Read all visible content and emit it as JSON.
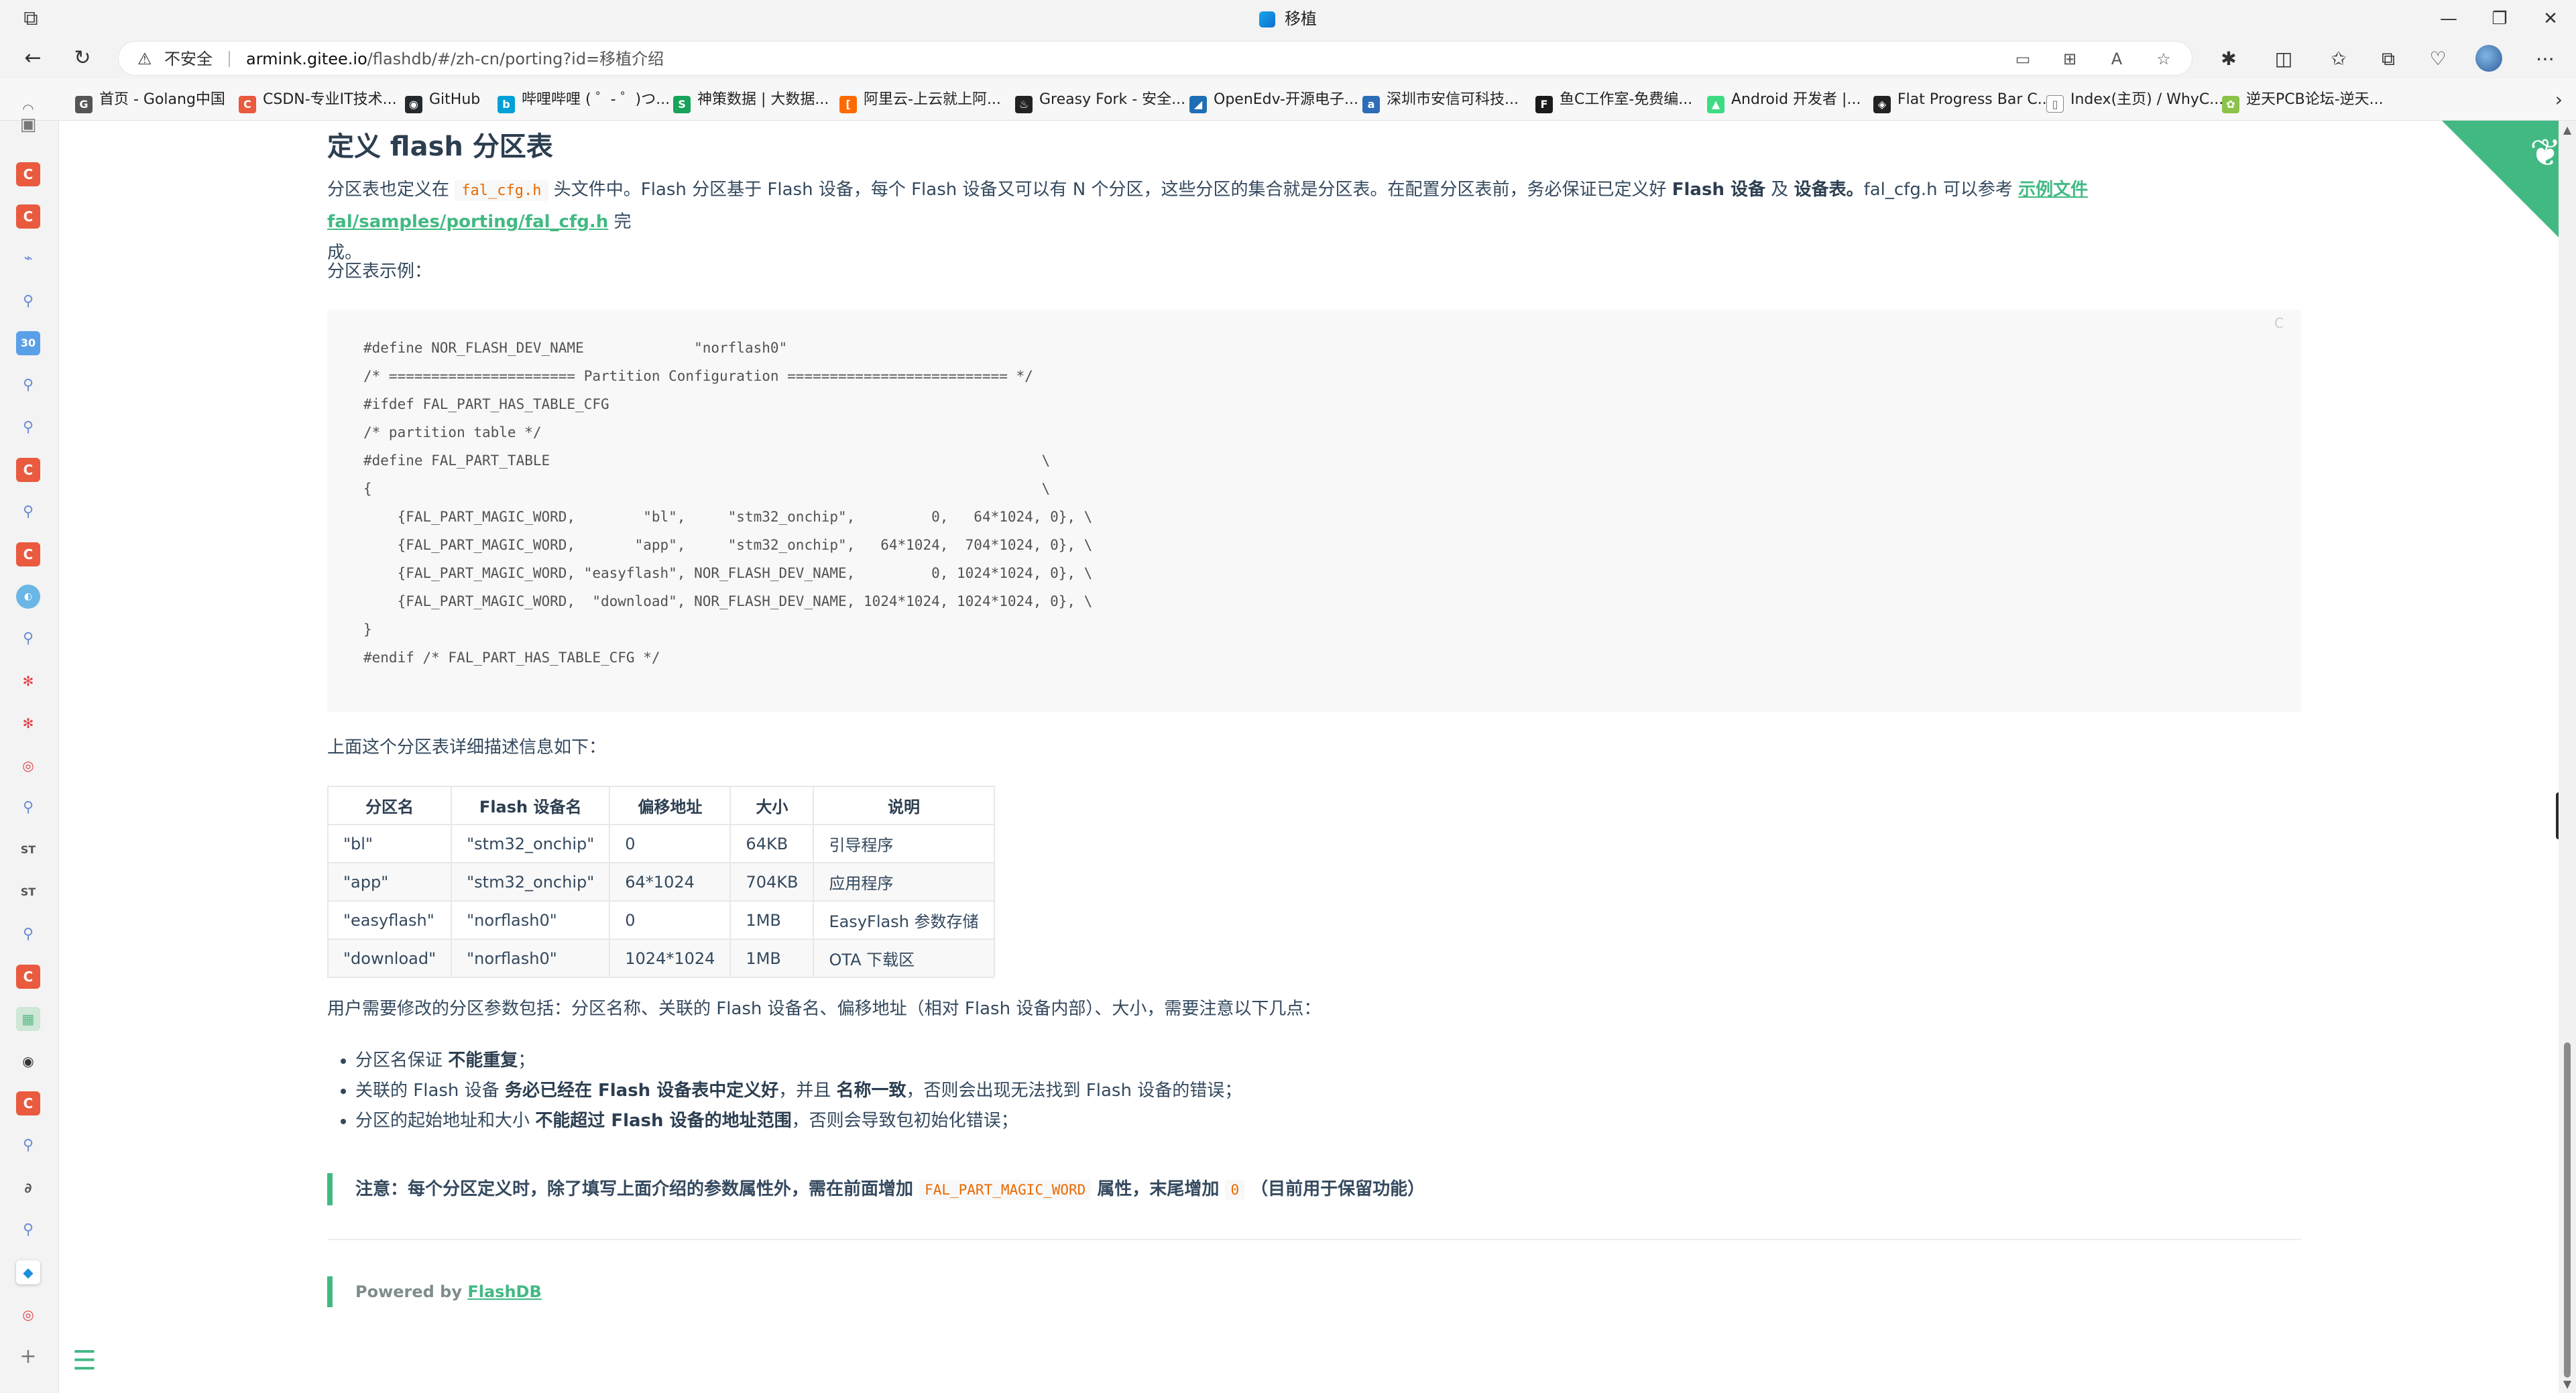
{
  "window": {
    "title": "移植",
    "wm_icon": "window-menu-icon",
    "minimize": "—",
    "restore": "❐",
    "close": "✕"
  },
  "navbar": {
    "back": "←",
    "reload": "↻",
    "insecure_label": "不安全",
    "url_host": "armink.gitee.io",
    "url_path": "/flashdb/#/zh-cn/porting?id=移植介绍",
    "more": "⋯"
  },
  "bookmarks": [
    {
      "label": "首页 - Golang中国",
      "icon": "gopher-icon",
      "color": "#444444"
    },
    {
      "label": "CSDN-专业IT技术...",
      "icon": "csdn-icon",
      "color": "#e95a3e"
    },
    {
      "label": "GitHub",
      "icon": "github-icon",
      "color": "#24292e"
    },
    {
      "label": "哔哩哔哩 ( ゜- ゜)つ...",
      "icon": "bilibili-icon",
      "color": "#00a1d6"
    },
    {
      "label": "神策数据 | 大数据...",
      "icon": "sensors-icon",
      "color": "#17a35b"
    },
    {
      "label": "阿里云-上云就上阿...",
      "icon": "aliyun-icon",
      "color": "#ff6a00"
    },
    {
      "label": "Greasy Fork - 安全...",
      "icon": "greasyfork-icon",
      "color": "#222222"
    },
    {
      "label": "OpenEdv-开源电子...",
      "icon": "openedv-icon",
      "color": "#1f6fb5"
    },
    {
      "label": "深圳市安信可科技...",
      "icon": "aithinker-icon",
      "color": "#2d6db8"
    },
    {
      "label": "鱼C工作室-免费编...",
      "icon": "fishc-icon",
      "color": "#1a1a1a"
    },
    {
      "label": "Android 开发者 |...",
      "icon": "android-icon",
      "color": "#3ddc84"
    },
    {
      "label": "Flat Progress Bar C...",
      "icon": "codepen-icon",
      "color": "#222222"
    },
    {
      "label": "Index(主页) / WhyC...",
      "icon": "page-icon",
      "color": "#666666"
    },
    {
      "label": "逆天PCB论坛-逆天...",
      "icon": "pcb-icon",
      "color": "#8bc34a"
    }
  ],
  "page": {
    "heading": "定义 flash 分区表",
    "intro": {
      "t1": "分区表也定义在",
      "code": "fal_cfg.h",
      "t2": "头文件中。Flash 分区基于 Flash 设备，每个 Flash 设备又可以有 N 个分区，这些分区的集合就是分区表。在配置分区表前，务必保证已定义好",
      "b1": "Flash 设备",
      "t3": "及",
      "b2": "设备表。",
      "t4": "fal_cfg.h 可以参考",
      "link": "示例文件 fal/samples/porting/fal_cfg.h",
      "t5": "完",
      "t6": "成。"
    },
    "example_label": "分区表示例：",
    "code_lang": "C",
    "code": "#define NOR_FLASH_DEV_NAME             \"norflash0\"\n/* ====================== Partition Configuration ========================== */\n#ifdef FAL_PART_HAS_TABLE_CFG\n/* partition table */\n#define FAL_PART_TABLE                                                          \\\n{                                                                               \\\n    {FAL_PART_MAGIC_WORD,        \"bl\",     \"stm32_onchip\",         0,   64*1024, 0}, \\\n    {FAL_PART_MAGIC_WORD,       \"app\",     \"stm32_onchip\",   64*1024,  704*1024, 0}, \\\n    {FAL_PART_MAGIC_WORD, \"easyflash\", NOR_FLASH_DEV_NAME,         0, 1024*1024, 0}, \\\n    {FAL_PART_MAGIC_WORD,  \"download\", NOR_FLASH_DEV_NAME, 1024*1024, 1024*1024, 0}, \\\n}\n#endif /* FAL_PART_HAS_TABLE_CFG */",
    "table_intro": "上面这个分区表详细描述信息如下：",
    "table": {
      "headers": [
        "分区名",
        "Flash 设备名",
        "偏移地址",
        "大小",
        "说明"
      ],
      "rows": [
        [
          "\"bl\"",
          "\"stm32_onchip\"",
          "0",
          "64KB",
          "引导程序"
        ],
        [
          "\"app\"",
          "\"stm32_onchip\"",
          "64*1024",
          "704KB",
          "应用程序"
        ],
        [
          "\"easyflash\"",
          "\"norflash0\"",
          "0",
          "1MB",
          "EasyFlash 参数存储"
        ],
        [
          "\"download\"",
          "\"norflash0\"",
          "1024*1024",
          "1MB",
          "OTA 下载区"
        ]
      ]
    },
    "params_text": "用户需要修改的分区参数包括：分区名称、关联的 Flash 设备名、偏移地址（相对 Flash 设备内部）、大小，需要注意以下几点：",
    "notes": [
      {
        "t1": "分区名保证",
        "b1": "不能重复",
        "t2": "；"
      },
      {
        "t1": "关联的 Flash 设备",
        "b1": "务必已经在 Flash 设备表中定义好",
        "t2": "，并且",
        "b2": "名称一致",
        "t3": "，否则会出现无法找到 Flash 设备的错误；"
      },
      {
        "t1": "分区的起始地址和大小",
        "b1": "不能超过 Flash 设备的地址范围",
        "t2": "，否则会导致包初始化错误；"
      }
    ],
    "tip": {
      "t1": "注意：每个分区定义时，除了填写上面介绍的参数属性外，需在前面增加",
      "code1": "FAL_PART_MAGIC_WORD",
      "t2": "属性，末尾增加",
      "code2": "0",
      "t3": "（目前用于保留功能）"
    },
    "footer": {
      "prefix": "Powered by",
      "link": "FlashDB"
    }
  },
  "colors": {
    "accent": "#42b983",
    "code_text": "#e96900",
    "body_text": "#34495e",
    "csdn_red": "#e95a3e"
  }
}
